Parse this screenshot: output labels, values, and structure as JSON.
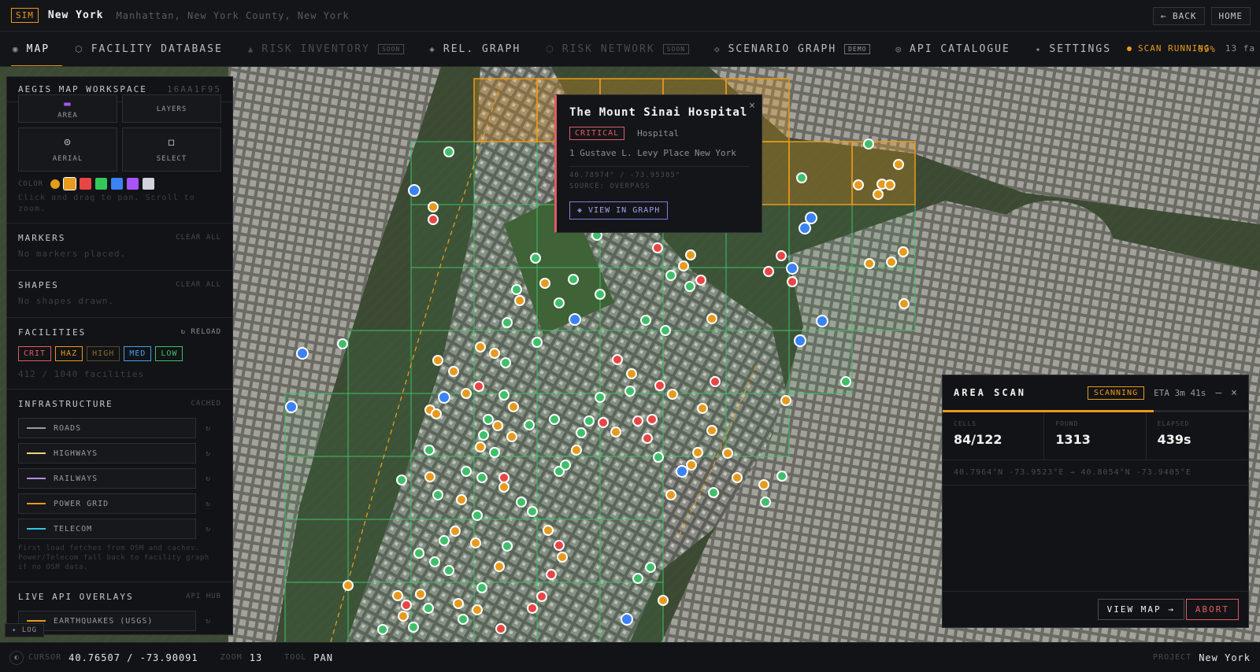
{
  "topbar": {
    "sim_badge": "SIM",
    "city": "New York",
    "location": "Manhattan, New York County, New York",
    "back": "← BACK",
    "home": "HOME"
  },
  "tabs": [
    {
      "label": "MAP",
      "icon": "target-icon",
      "glyph": "◉",
      "active": true
    },
    {
      "label": "FACILITY DATABASE",
      "icon": "hexagon-icon",
      "glyph": "⬡"
    },
    {
      "label": "RISK INVENTORY",
      "icon": "triangle-icon",
      "glyph": "▲",
      "disabled": true,
      "tag": "SOON"
    },
    {
      "label": "REL. GRAPH",
      "icon": "diamond-icon",
      "glyph": "◈"
    },
    {
      "label": "RISK NETWORK",
      "icon": "hexagon-icon",
      "glyph": "⬡",
      "disabled": true,
      "tag": "SOON"
    },
    {
      "label": "SCENARIO GRAPH",
      "icon": "diamond-outline-icon",
      "glyph": "◇",
      "tag": "DEMO"
    },
    {
      "label": "API CATALOGUE",
      "icon": "target-icon",
      "glyph": "◎"
    },
    {
      "label": "SETTINGS",
      "icon": "star-icon",
      "glyph": "✦"
    }
  ],
  "scan_status": {
    "label": "SCAN RUNNING",
    "percent": "69%",
    "extra": "13 fa"
  },
  "left_panel": {
    "title": "AEGIS MAP WORKSPACE",
    "id": "16AA1F95",
    "tools": [
      {
        "label": "AREA",
        "icon": "area-icon",
        "glyph": "▬"
      },
      {
        "label": "LAYERS",
        "icon": "layers-icon",
        "glyph": ""
      },
      {
        "label": "AERIAL",
        "icon": "aerial-icon",
        "glyph": "⊙"
      },
      {
        "label": "SELECT",
        "icon": "select-icon",
        "glyph": "◻"
      }
    ],
    "color_label": "COLOR",
    "colors": [
      "#e89a1d",
      "#e84545",
      "#34c759",
      "#3b82f6",
      "#a855f7",
      "#d1d5db"
    ],
    "hint": "Click and drag to pan. Scroll to zoom.",
    "markers": {
      "title": "MARKERS",
      "action": "CLEAR ALL",
      "empty": "No markers placed."
    },
    "shapes": {
      "title": "SHAPES",
      "action": "CLEAR ALL",
      "empty": "No shapes drawn."
    },
    "facilities": {
      "title": "FACILITIES",
      "action": "RELOAD",
      "filters": [
        {
          "label": "CRIT",
          "color": "#e05a66"
        },
        {
          "label": "HAZ",
          "color": "#e89a1d"
        },
        {
          "label": "HIGH",
          "color": "#8a6a2a"
        },
        {
          "label": "MED",
          "color": "#4a9bf0"
        },
        {
          "label": "LOW",
          "color": "#3fbf6a"
        }
      ],
      "count": "412 / 1040 facilities"
    },
    "infrastructure": {
      "title": "INFRASTRUCTURE",
      "action": "CACHED",
      "items": [
        {
          "label": "ROADS",
          "color": "#9a9ba0"
        },
        {
          "label": "HIGHWAYS",
          "color": "#f0d27a"
        },
        {
          "label": "RAILWAYS",
          "color": "#b48ee8"
        },
        {
          "label": "POWER GRID",
          "color": "#e89a1d"
        },
        {
          "label": "TELECOM",
          "color": "#2ec7e8"
        }
      ],
      "note": "First load fetches from OSM and caches. Power/Telecom fall back to facility graph if no OSM data."
    },
    "live_api": {
      "title": "LIVE API OVERLAYS",
      "action": "API HUB",
      "items": [
        {
          "label": "EARTHQUAKES (USGS)",
          "color": "#e89a1d"
        }
      ]
    },
    "log_label": "LOG"
  },
  "popup": {
    "title": "The Mount Sinai Hospital",
    "severity": "CRITICAL",
    "type": "Hospital",
    "address": "1 Gustave L. Levy Place New York",
    "coords": "40.78974° / -73.95385°",
    "source": "SOURCE: OVERPASS",
    "button": "◈ VIEW IN GRAPH",
    "close": "×"
  },
  "area_scan": {
    "title": "AREA SCAN",
    "status": "SCANNING",
    "eta": "ETA 3m 41s",
    "minimize": "—",
    "close": "×",
    "progress": 0.69,
    "stats": [
      {
        "label": "CELLS",
        "value": "84/122"
      },
      {
        "label": "FOUND",
        "value": "1313"
      },
      {
        "label": "ELAPSED",
        "value": "439s"
      }
    ],
    "coords": "40.7964°N -73.9523°E → 40.8054°N -73.9405°E",
    "view_map": "VIEW MAP →",
    "abort": "ABORT"
  },
  "statusbar": {
    "cursor_label": "CURSOR",
    "cursor": "40.76507 / -73.90091",
    "zoom_label": "ZOOM",
    "zoom": "13",
    "tool_label": "TOOL",
    "tool": "PAN",
    "project_label": "PROJECT",
    "project": "New York"
  }
}
